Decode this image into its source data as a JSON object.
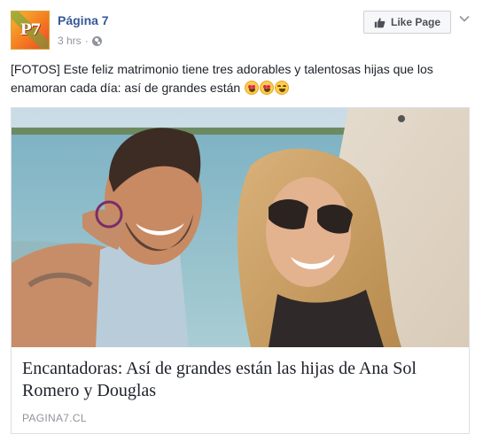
{
  "page": {
    "name": "Página 7",
    "avatar_text": "P7",
    "time": "3 hrs",
    "separator": "·",
    "audience_icon": "globe-icon"
  },
  "actions": {
    "like_page_label": "Like Page",
    "like_icon": "thumbs-up-icon",
    "menu_icon": "chevron-down-icon"
  },
  "post": {
    "text": "[FOTOS] Este feliz matrimonio tiene tres adorables y talentosas hijas que los enamoran cada día: así de grandes están",
    "emojis": [
      "heart-eyes-emoji",
      "heart-eyes-emoji",
      "grinning-smiling-eyes-emoji"
    ]
  },
  "link_card": {
    "title": "Encantadoras: Así de grandes están las hijas de Ana Sol Romero y Douglas",
    "domain": "PAGINA7.CL"
  },
  "colors": {
    "link_blue": "#365899",
    "meta_gray": "#90949c",
    "border": "#dddfe2"
  }
}
